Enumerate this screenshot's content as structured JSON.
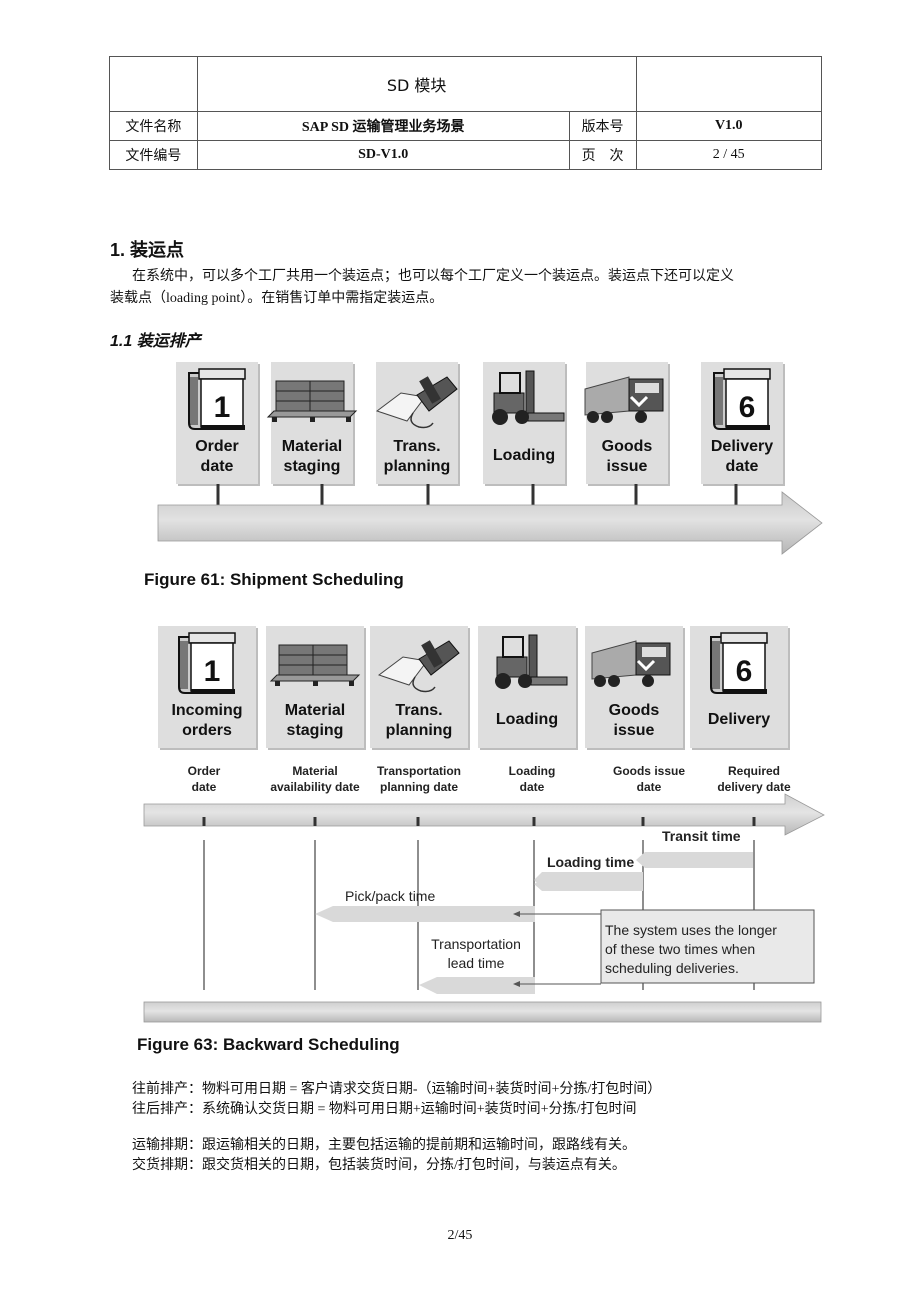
{
  "header_table": {
    "module_title": "SD 模块",
    "rows": [
      {
        "label": "文件名称",
        "value": "SAP SD 运输管理业务场景",
        "label2": "版本号",
        "value2": "V1.0"
      },
      {
        "label": "文件编号",
        "value": "SD-V1.0",
        "label2": "页　次",
        "value2": "2 / 45"
      }
    ]
  },
  "section": {
    "heading": "1. 装运点",
    "paragraph_line1": "在系统中，可以多个工厂共用一个装运点；也可以每个工厂定义一个装运点。装运点下还可以定义",
    "paragraph_line2": "装载点（loading point）。在销售订单中需指定装运点。",
    "subheading": "1.1 装运排产"
  },
  "figure61": {
    "caption": "Figure 61:  Shipment Scheduling",
    "steps": [
      {
        "icon": "calendar-icon",
        "icon_number": "1",
        "line1": "Order",
        "line2": "date"
      },
      {
        "icon": "pallet-icon",
        "line1": "Material",
        "line2": "staging"
      },
      {
        "icon": "telephone-icon",
        "line1": "Trans.",
        "line2": "planning"
      },
      {
        "icon": "forklift-icon",
        "line1": "Loading",
        "line2": ""
      },
      {
        "icon": "truck-icon",
        "line1": "Goods",
        "line2": "issue"
      },
      {
        "icon": "calendar-icon",
        "icon_number": "6",
        "line1": "Delivery",
        "line2": "date"
      }
    ]
  },
  "figure63": {
    "caption": "Figure 63:  Backward Scheduling",
    "steps": [
      {
        "icon": "calendar-icon",
        "icon_number": "1",
        "line1": "Incoming",
        "line2": "orders",
        "date1": "Order",
        "date2": "date"
      },
      {
        "icon": "pallet-icon",
        "line1": "Material",
        "line2": "staging",
        "date1": "Material",
        "date2": "availability date"
      },
      {
        "icon": "telephone-icon",
        "line1": "Trans.",
        "line2": "planning",
        "date1": "Transportation",
        "date2": "planning date"
      },
      {
        "icon": "forklift-icon",
        "line1": "Loading",
        "line2": "",
        "date1": "Loading",
        "date2": "date"
      },
      {
        "icon": "truck-icon",
        "line1": "Goods",
        "line2": "issue",
        "date1": "Goods issue",
        "date2": "date"
      },
      {
        "icon": "calendar-icon",
        "icon_number": "6",
        "line1": "Delivery",
        "line2": "",
        "date1": "Required",
        "date2": "delivery date"
      }
    ],
    "durations": {
      "transit": "Transit time",
      "loading": "Loading time",
      "pickpack": "Pick/pack time",
      "transport_lead1": "Transportation",
      "transport_lead2": "lead time"
    },
    "note_line1": "The system uses the longer",
    "note_line2": "of these two times when",
    "note_line3": "scheduling deliveries."
  },
  "formulas": {
    "forward": "往前排产：物料可用日期 = 客户请求交货日期-（运输时间+装货时间+分拣/打包时间）",
    "backward": "往后排产：系统确认交货日期 = 物料可用日期+运输时间+装货时间+分拣/打包时间",
    "transport": "运输排期：跟运输相关的日期，主要包括运输的提前期和运输时间，跟路线有关。",
    "delivery": "交货排期：跟交货相关的日期，包括装货时间，分拣/打包时间，与装运点有关。"
  },
  "footer": {
    "page": "2/45"
  }
}
